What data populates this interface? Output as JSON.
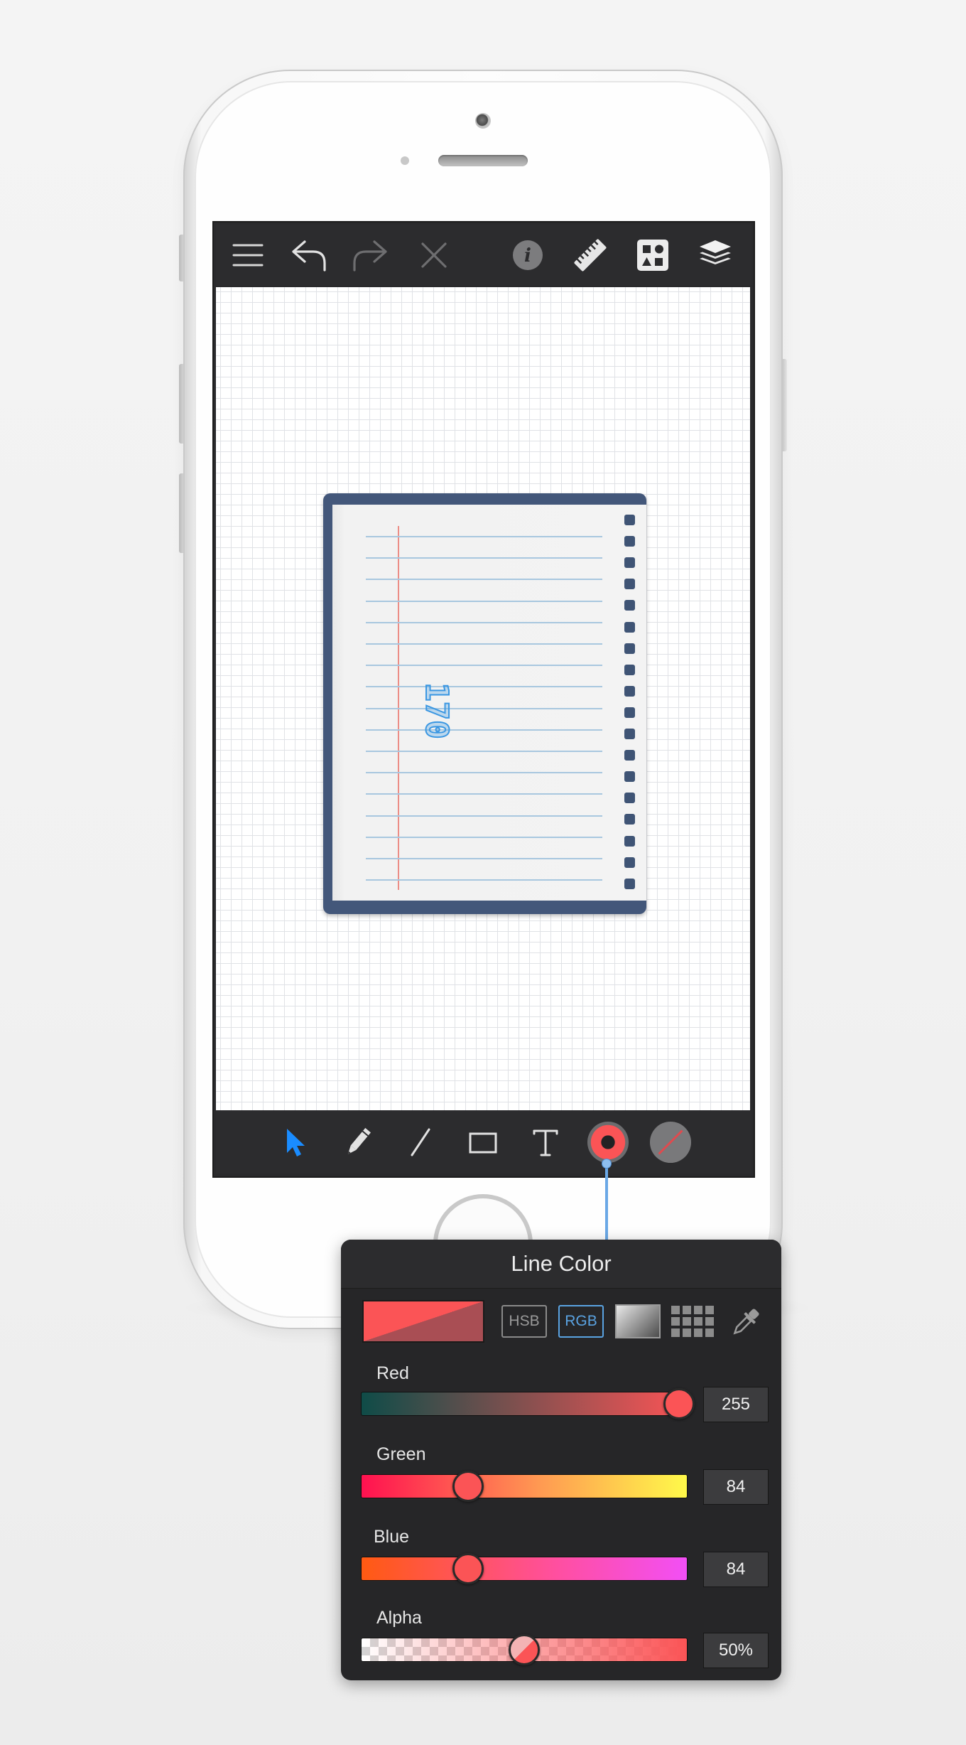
{
  "toolbar_top": {
    "icons": [
      "menu-icon",
      "undo-icon",
      "redo-icon",
      "close-icon",
      "info-icon",
      "ruler-icon",
      "shapes-library-icon",
      "layers-icon"
    ]
  },
  "canvas": {
    "drawing_text": "170"
  },
  "toolbar_bottom": {
    "icons": [
      "select-arrow-icon",
      "pencil-icon",
      "line-tool-icon",
      "rectangle-tool-icon",
      "text-tool-icon",
      "line-color-icon",
      "fill-color-icon"
    ],
    "active_tool": "select-arrow-icon",
    "line_color": "#fb5456",
    "fill_color": "none"
  },
  "popover": {
    "title": "Line Color",
    "modes": {
      "hsb": "HSB",
      "rgb": "RGB",
      "active": "RGB"
    },
    "current_color": "#fb5456",
    "sliders": [
      {
        "label": "Red",
        "value": "255",
        "fraction": 1.0
      },
      {
        "label": "Green",
        "value": "84",
        "fraction": 0.329
      },
      {
        "label": "Blue",
        "value": "84",
        "fraction": 0.329
      },
      {
        "label": "Alpha",
        "value": "50%",
        "fraction": 0.5
      }
    ]
  },
  "colors": {
    "accent_blue": "#1a8cff",
    "selection_blue": "#5aa3e2",
    "line_red": "#fb5456",
    "notebook_blue": "#43577a"
  }
}
